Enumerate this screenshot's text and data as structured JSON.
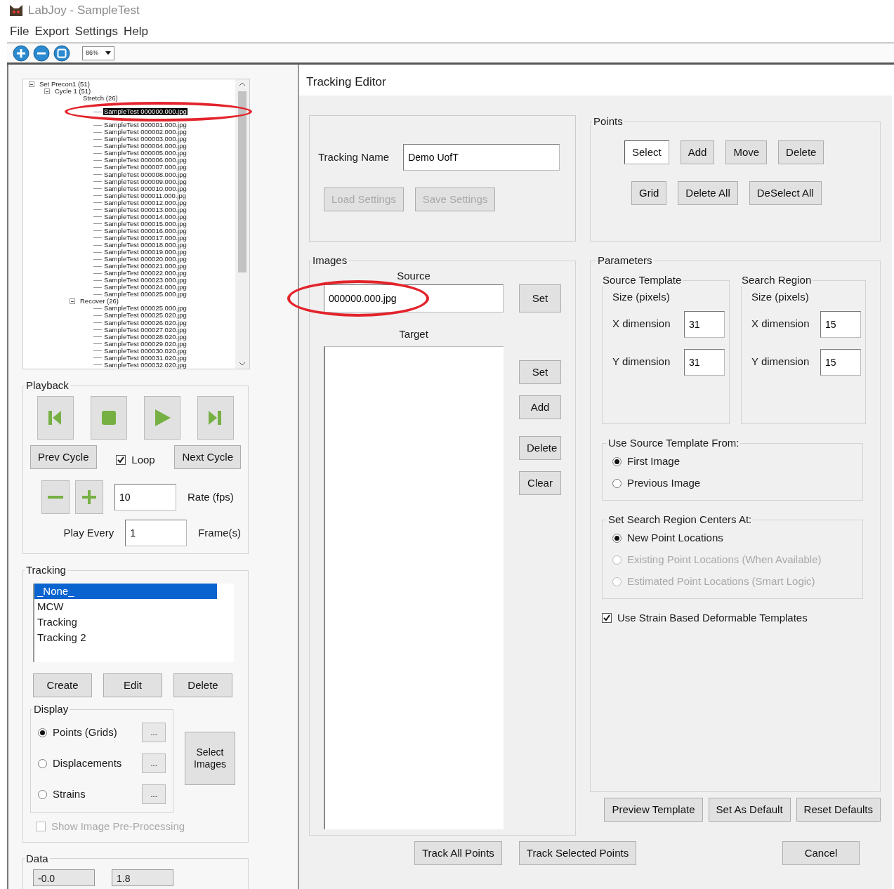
{
  "window": {
    "title": "LabJoy - SampleTest"
  },
  "menu": [
    "File",
    "Export",
    "Settings",
    "Help"
  ],
  "toolbar": {
    "zoom": "86%"
  },
  "tree": [
    {
      "label": "Set Precon1 (51)",
      "expanded": true,
      "children": [
        {
          "label": "Cycle 1 (51)",
          "expanded": true,
          "children": [
            {
              "label": "Stretch (26)",
              "children": [
                {
                  "label": "SampleTest 000000.000.jpg",
                  "selected": true,
                  "circled": true
                },
                {
                  "label": "SampleTest 000001.000.jpg",
                  "selected": false,
                  "circled": false
                },
                {
                  "label": "SampleTest 000002.000.jpg",
                  "selected": false,
                  "circled": false
                },
                {
                  "label": "SampleTest 000003.000.jpg",
                  "selected": false,
                  "circled": false
                },
                {
                  "label": "SampleTest 000004.000.jpg",
                  "selected": false,
                  "circled": false
                },
                {
                  "label": "SampleTest 000005.000.jpg",
                  "selected": false,
                  "circled": false
                },
                {
                  "label": "SampleTest 000006.000.jpg",
                  "selected": false,
                  "circled": false
                },
                {
                  "label": "SampleTest 000007.000.jpg",
                  "selected": false,
                  "circled": false
                },
                {
                  "label": "SampleTest 000008.000.jpg",
                  "selected": false,
                  "circled": false
                },
                {
                  "label": "SampleTest 000009.000.jpg",
                  "selected": false,
                  "circled": false
                },
                {
                  "label": "SampleTest 000010.000.jpg",
                  "selected": false,
                  "circled": false
                },
                {
                  "label": "SampleTest 000011.000.jpg",
                  "selected": false,
                  "circled": false
                },
                {
                  "label": "SampleTest 000012.000.jpg",
                  "selected": false,
                  "circled": false
                },
                {
                  "label": "SampleTest 000013.000.jpg",
                  "selected": false,
                  "circled": false
                },
                {
                  "label": "SampleTest 000014.000.jpg",
                  "selected": false,
                  "circled": false
                },
                {
                  "label": "SampleTest 000015.000.jpg",
                  "selected": false,
                  "circled": false
                },
                {
                  "label": "SampleTest 000016.000.jpg",
                  "selected": false,
                  "circled": false
                },
                {
                  "label": "SampleTest 000017.000.jpg",
                  "selected": false,
                  "circled": false
                },
                {
                  "label": "SampleTest 000018.000.jpg",
                  "selected": false,
                  "circled": false
                },
                {
                  "label": "SampleTest 000019.000.jpg",
                  "selected": false,
                  "circled": false
                },
                {
                  "label": "SampleTest 000020.000.jpg",
                  "selected": false,
                  "circled": false
                },
                {
                  "label": "SampleTest 000021.000.jpg",
                  "selected": false,
                  "circled": false
                },
                {
                  "label": "SampleTest 000022.000.jpg",
                  "selected": false,
                  "circled": false
                },
                {
                  "label": "SampleTest 000023.000.jpg",
                  "selected": false,
                  "circled": false
                },
                {
                  "label": "SampleTest 000024.000.jpg",
                  "selected": false,
                  "circled": false
                },
                {
                  "label": "SampleTest 000025.000.jpg",
                  "selected": false,
                  "circled": false
                }
              ]
            },
            {
              "label": "Recover (26)",
              "expanded": true,
              "children": [
                {
                  "label": "SampleTest 000025.000.jpg",
                  "selected": false,
                  "circled": false
                },
                {
                  "label": "SampleTest 000025.020.jpg",
                  "selected": false,
                  "circled": false
                },
                {
                  "label": "SampleTest 000026.020.jpg",
                  "selected": false,
                  "circled": false
                },
                {
                  "label": "SampleTest 000027.020.jpg",
                  "selected": false,
                  "circled": false
                },
                {
                  "label": "SampleTest 000028.020.jpg",
                  "selected": false,
                  "circled": false
                },
                {
                  "label": "SampleTest 000029.020.jpg",
                  "selected": false,
                  "circled": false
                },
                {
                  "label": "SampleTest 000030.020.jpg",
                  "selected": false,
                  "circled": false
                },
                {
                  "label": "SampleTest 000031.020.jpg",
                  "selected": false,
                  "circled": false
                },
                {
                  "label": "SampleTest 000032.020.jpg",
                  "selected": false,
                  "circled": false
                }
              ]
            }
          ]
        }
      ]
    }
  ],
  "playback": {
    "title": "Playback",
    "prev_cycle": "Prev Cycle",
    "loop": {
      "label": "Loop",
      "checked": true
    },
    "next_cycle": "Next Cycle",
    "rate_value": "10",
    "rate_unit": "Rate (fps)",
    "play_every_label": "Play Every",
    "play_every_value": "1",
    "play_every_unit": "Frame(s)"
  },
  "tracking": {
    "title": "Tracking",
    "items": [
      {
        "label": "_None_",
        "selected": true
      },
      {
        "label": "MCW",
        "selected": false
      },
      {
        "label": "Tracking",
        "selected": false
      },
      {
        "label": "Tracking 2",
        "selected": false
      }
    ],
    "buttons": [
      "Create",
      "Edit",
      "Delete"
    ],
    "display": {
      "title": "Display",
      "options": [
        {
          "label": "Points (Grids)",
          "selected": true,
          "more": "..."
        },
        {
          "label": "Displacements",
          "selected": false,
          "more": "..."
        },
        {
          "label": "Strains",
          "selected": false,
          "more": "..."
        }
      ]
    },
    "select_images": "Select Images",
    "preprocessing": {
      "label": "Show Image Pre-Processing",
      "checked": false,
      "disabled": true
    }
  },
  "data": {
    "title": "Data",
    "values": [
      "-0.0",
      "1.8"
    ]
  },
  "editor": {
    "title": "Tracking Editor",
    "name_label": "Tracking Name",
    "name_value": "Demo UofT",
    "settings_buttons": [
      {
        "label": "Load Settings",
        "disabled": true
      },
      {
        "label": "Save Settings",
        "disabled": true
      }
    ],
    "points": {
      "title": "Points",
      "buttons": [
        {
          "label": "Select",
          "selected": true
        },
        {
          "label": "Add",
          "selected": false
        },
        {
          "label": "Move",
          "selected": false
        },
        {
          "label": "Delete",
          "selected": false
        }
      ],
      "buttons_2": [
        "Grid",
        "Delete All",
        "DeSelect All"
      ]
    },
    "images": {
      "title": "Images",
      "source_label": "Source",
      "source_value": "000000.000.jpg",
      "source_circled": true,
      "source_set": "Set",
      "target_label": "Target",
      "target_buttons": [
        "Set",
        "Add",
        "Delete",
        "Clear"
      ]
    },
    "parameters": {
      "title": "Parameters",
      "regions": [
        {
          "title": "Source Template",
          "size_label": "Size (pixels)",
          "x_label": "X dimension",
          "x_value": "31",
          "y_label": "Y dimension",
          "y_value": "31"
        },
        {
          "title": "Search Region",
          "size_label": "Size (pixels)",
          "x_label": "X dimension",
          "x_value": "15",
          "y_label": "Y dimension",
          "y_value": "15"
        }
      ],
      "template_from": {
        "title": "Use Source Template From:",
        "options": [
          {
            "label": "First Image",
            "selected": true,
            "disabled": false
          },
          {
            "label": "Previous Image",
            "selected": false,
            "disabled": false
          }
        ]
      },
      "centers_at": {
        "title": "Set Search Region Centers At:",
        "options": [
          {
            "label": "New Point Locations",
            "selected": true,
            "disabled": false
          },
          {
            "label": "Existing Point Locations (When Available)",
            "selected": false,
            "disabled": true
          },
          {
            "label": "Estimated Point Locations (Smart Logic)",
            "selected": false,
            "disabled": true
          }
        ]
      },
      "strain": {
        "label": "Use Strain Based Deformable Templates",
        "checked": true
      },
      "buttons": [
        "Preview Template",
        "Set As Default",
        "Reset Defaults"
      ]
    },
    "actions": [
      "Track All Points",
      "Track Selected Points",
      "Cancel"
    ]
  }
}
